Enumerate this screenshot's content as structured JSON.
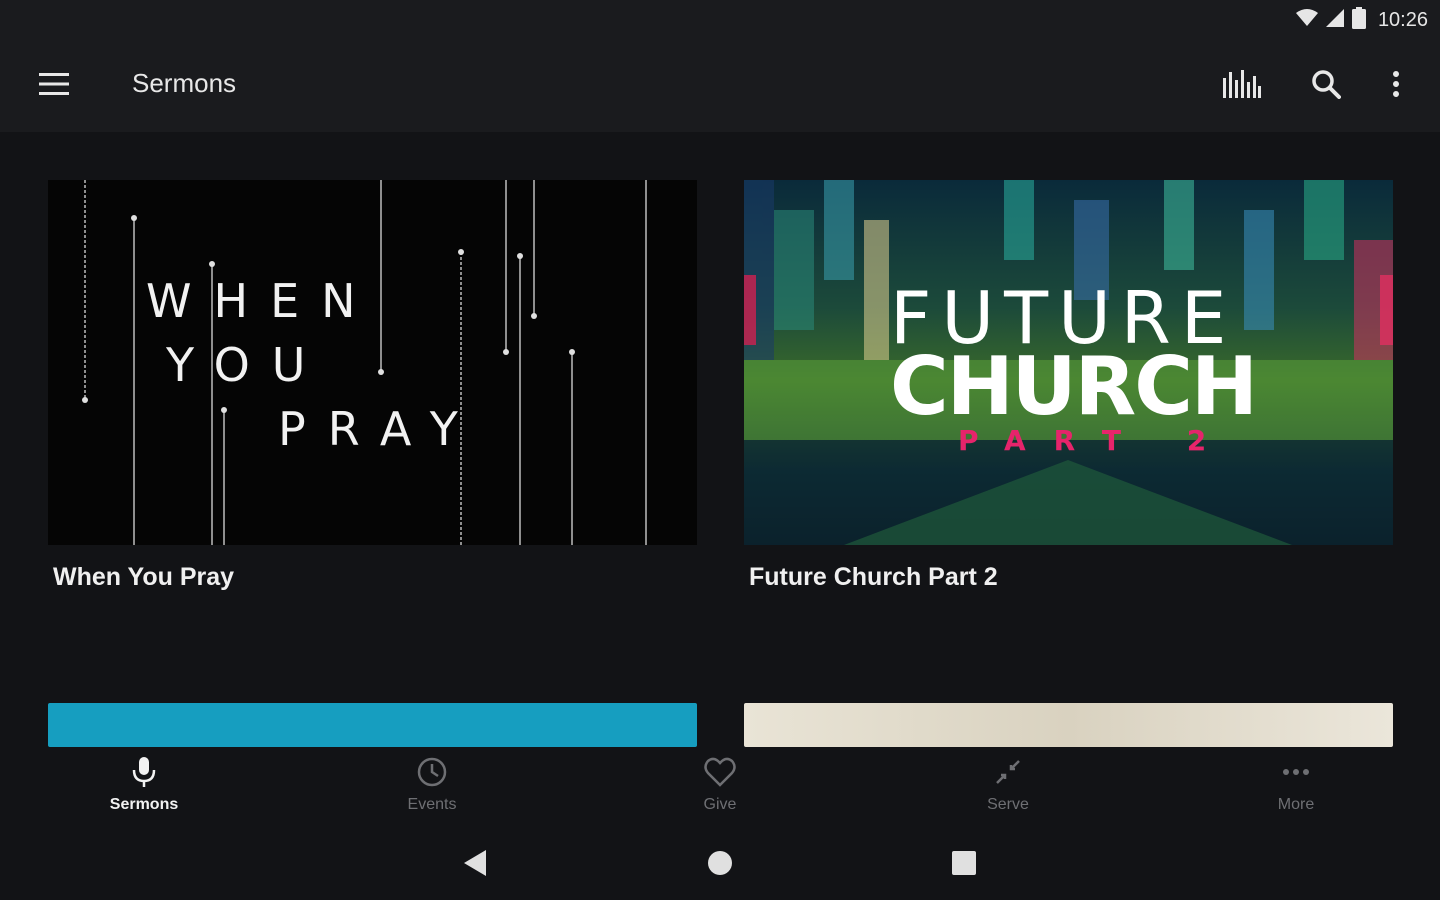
{
  "status_bar": {
    "time": "10:26",
    "icons": [
      "wifi-icon",
      "cellular-signal-icon",
      "battery-icon"
    ]
  },
  "app_bar": {
    "title": "Sermons",
    "icons": [
      "menu-icon",
      "equalizer-icon",
      "search-icon",
      "overflow-menu-icon"
    ]
  },
  "sermons": [
    {
      "title": "When You Pray",
      "art_lines": [
        "WHEN",
        "YOU",
        "PRAY"
      ]
    },
    {
      "title": "Future Church Part 2",
      "art_lines": [
        "FUTURE",
        "CHURCH",
        "PART 2"
      ]
    }
  ],
  "bottom_nav": {
    "items": [
      {
        "label": "Sermons",
        "icon": "microphone-icon",
        "active": true
      },
      {
        "label": "Events",
        "icon": "clock-icon",
        "active": false
      },
      {
        "label": "Give",
        "icon": "heart-icon",
        "active": false
      },
      {
        "label": "Serve",
        "icon": "collapse-arrows-icon",
        "active": false
      },
      {
        "label": "More",
        "icon": "more-dots-icon",
        "active": false
      }
    ]
  },
  "system_nav": {
    "icons": [
      "back-icon",
      "home-icon",
      "recents-icon"
    ]
  },
  "colors": {
    "background": "#121316",
    "app_bar": "#1a1b1e",
    "accent_pink": "#e6246b",
    "teal_card": "#169ec0",
    "inactive_nav": "#6e6f73"
  }
}
